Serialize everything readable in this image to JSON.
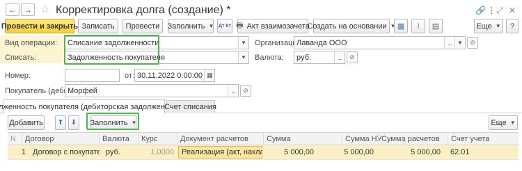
{
  "window": {
    "title": "Корректировка долга (создание) *",
    "back_icon": "arrow-left-icon",
    "forward_icon": "arrow-right-icon",
    "star_icon": "star-icon",
    "link_icon": "link-icon",
    "more_icon": "kebab-icon",
    "maximize_icon": "maximize-icon",
    "close_icon": "close-icon"
  },
  "toolbar": {
    "post_close_label": "Провести и закрыть",
    "save_label": "Записать",
    "post_label": "Провести",
    "fill_label": "Заполнить",
    "dt_kt_label": "Дт Кт",
    "netting_act_label": "Акт взаимозачета",
    "based_on_label": "Создать на основании",
    "more_label": "Еще"
  },
  "form": {
    "operation_label": "Вид операции:",
    "operation_value": "Списание задолженности",
    "writeoff_label": "Списать:",
    "writeoff_value": "Задолженность покупателя",
    "organization_label": "Организация:",
    "organization_value": "Лаванда ООО",
    "currency_label": "Валюта:",
    "currency_value": "руб.",
    "number_label": "Номер:",
    "number_value": "",
    "date_label": "от:",
    "date_value": "30.11.2022  0:00:00",
    "buyer_label": "Покупатель (дебитор):",
    "buyer_value": "Морфей"
  },
  "tabs": [
    {
      "label": "Задолженность покупателя (дебиторская задолженность)",
      "active": true
    },
    {
      "label": "Счет списания",
      "active": false
    }
  ],
  "table_toolbar": {
    "add_label": "Добавить",
    "fill_label": "Заполнить",
    "more_label": "Еще"
  },
  "table": {
    "columns": [
      "N",
      "Договор",
      "Валюта",
      "Курс",
      "Документ расчетов",
      "Сумма",
      "Сумма НУ",
      "Сумма расчетов",
      "Счет учета"
    ],
    "rows": [
      {
        "n": "1",
        "contract": "Договор с покупателем",
        "currency": "руб.",
        "rate": "1,0000",
        "document": "Реализация (акт, накладна...",
        "amount": "5 000,00",
        "amount_nu": "5 000,00",
        "amount_settlement": "5 000,00",
        "account": "62.01"
      }
    ]
  },
  "colors": {
    "primary_button": "#f6cf3a",
    "highlight_green": "#4cb84c",
    "selected_row": "#fbf0c4",
    "label_band": "#fdf4d2"
  }
}
